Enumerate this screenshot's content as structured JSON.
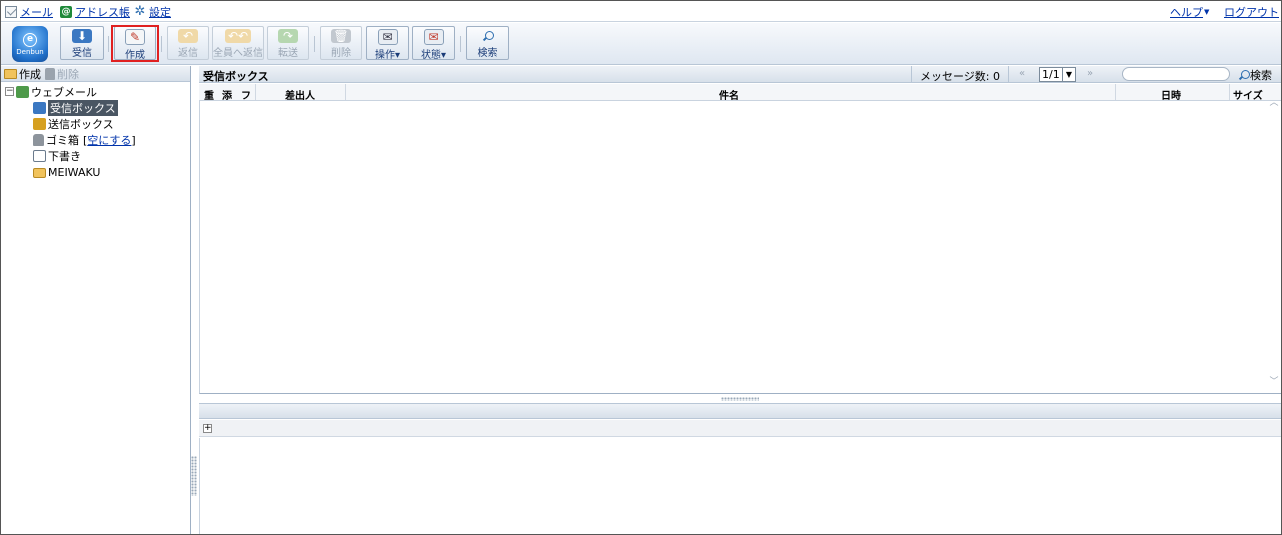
{
  "topnav": {
    "mail": "メール",
    "address_book": "アドレス帳",
    "settings": "設定",
    "help": "ヘルプ",
    "logout": "ログアウト"
  },
  "logo": {
    "text": "Denbun"
  },
  "toolbar": {
    "receive": "受信",
    "compose": "作成",
    "reply": "返信",
    "reply_all": "全員へ返信",
    "forward": "転送",
    "delete": "削除",
    "operation": "操作",
    "status": "状態",
    "search": "検索"
  },
  "leftpane": {
    "create": "作成",
    "delete": "削除",
    "tree_root": "ウェブメール",
    "folders": [
      {
        "label": "受信ボックス",
        "selected": true
      },
      {
        "label": "送信ボックス"
      },
      {
        "label": "ゴミ箱",
        "action": "空にする"
      },
      {
        "label": "下書き"
      },
      {
        "label": "MEIWAKU"
      }
    ]
  },
  "list": {
    "title": "受信ボックス",
    "message_count": "メッセージ数: 0",
    "page_prev": "«",
    "page_next": "»",
    "page": "1/1",
    "search_placeholder": "",
    "search_button": "検索",
    "columns": {
      "importance": "重",
      "attachment": "添",
      "flag": "フ",
      "sender": "差出人",
      "subject": "件名",
      "date": "日時",
      "size": "サイズ"
    }
  },
  "colors": {
    "accent": "#1f6fc9",
    "highlight": "#e02020",
    "header_bg": "#dfe7f1"
  }
}
